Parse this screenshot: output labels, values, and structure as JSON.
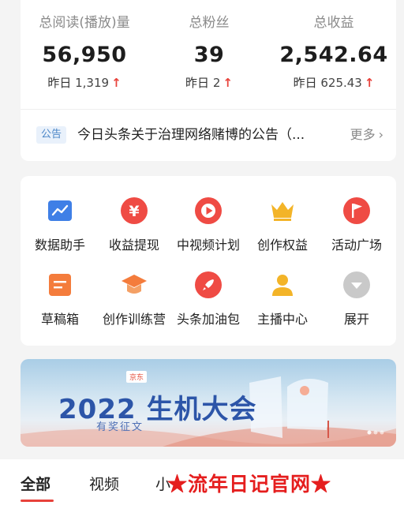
{
  "stats": [
    {
      "label": "总阅读(播放)量",
      "value": "56,950",
      "yesterday_label": "昨日",
      "yesterday_value": "1,319"
    },
    {
      "label": "总粉丝",
      "value": "39",
      "yesterday_label": "昨日",
      "yesterday_value": "2"
    },
    {
      "label": "总收益",
      "value": "2,542.64",
      "yesterday_label": "昨日",
      "yesterday_value": "625.43"
    }
  ],
  "notice": {
    "tag": "公告",
    "text": "今日头条关于治理网络赌博的公告（...",
    "more": "更多"
  },
  "tools": [
    {
      "label": "数据助手",
      "icon": "chart-icon",
      "color": "#3f7fe6"
    },
    {
      "label": "收益提现",
      "icon": "yuan-icon",
      "color": "#ef4b44"
    },
    {
      "label": "中视频计划",
      "icon": "play-icon",
      "color": "#ef4b44"
    },
    {
      "label": "创作权益",
      "icon": "crown-icon",
      "color": "#f3b428"
    },
    {
      "label": "活动广场",
      "icon": "flag-icon",
      "color": "#ef4b44"
    },
    {
      "label": "草稿箱",
      "icon": "draft-icon",
      "color": "#f47c3c"
    },
    {
      "label": "创作训练营",
      "icon": "graduation-cap-icon",
      "color": "#f47c3c"
    },
    {
      "label": "头条加油包",
      "icon": "rocket-icon",
      "color": "#ef4b44"
    },
    {
      "label": "主播中心",
      "icon": "user-icon",
      "color": "#f3b428"
    },
    {
      "label": "展开",
      "icon": "chevron-down-icon",
      "color": "#c9c9c9"
    }
  ],
  "banner": {
    "title": "2022 生机大会",
    "subtitle": "有奖征文",
    "brand": "京东"
  },
  "tabs": [
    "全部",
    "视频",
    "小"
  ],
  "watermark": "★流年日记官网★"
}
